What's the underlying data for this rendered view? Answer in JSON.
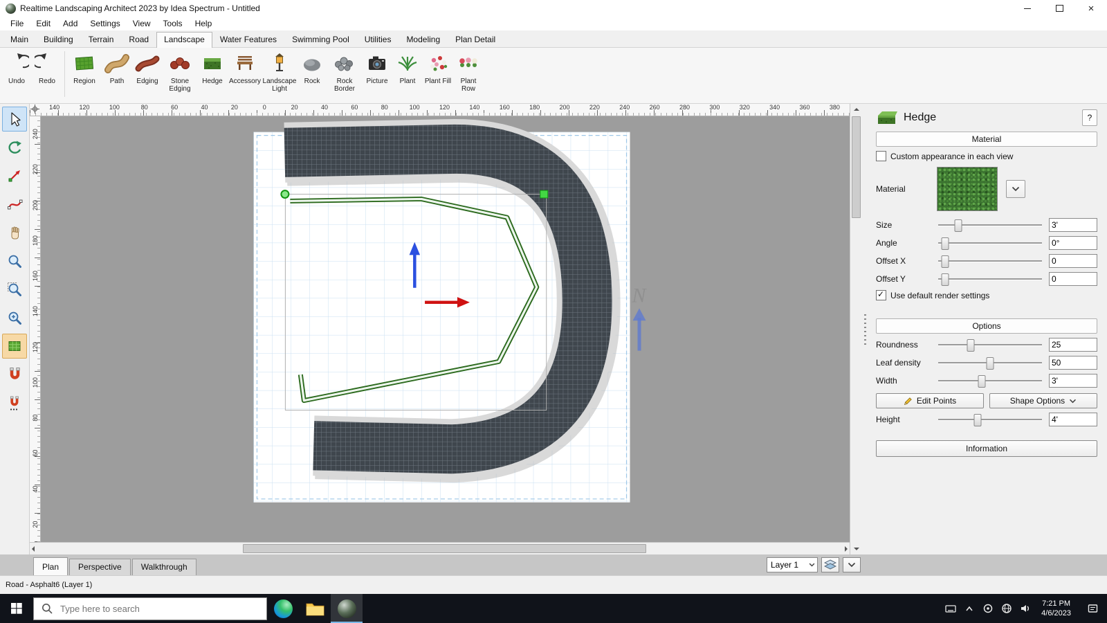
{
  "window": {
    "title": "Realtime Landscaping Architect 2023 by Idea Spectrum - Untitled"
  },
  "menu": [
    "File",
    "Edit",
    "Add",
    "Settings",
    "View",
    "Tools",
    "Help"
  ],
  "ribbon": {
    "tabs": [
      "Main",
      "Building",
      "Terrain",
      "Road",
      "Landscape",
      "Water Features",
      "Swimming Pool",
      "Utilities",
      "Modeling",
      "Plan Detail"
    ],
    "active_tab": "Landscape"
  },
  "toolbar": {
    "labels": [
      "Undo",
      "Redo",
      "Region",
      "Path",
      "Edging",
      "Stone Edging",
      "Hedge",
      "Accessory",
      "Landscape Light",
      "Rock",
      "Rock Border",
      "Picture",
      "Plant",
      "Plant Fill",
      "Plant Row"
    ]
  },
  "rulers": {
    "horizontal": [
      "140",
      "120",
      "100",
      "80",
      "60",
      "40",
      "20",
      "0",
      "20",
      "40",
      "60",
      "80",
      "100",
      "120",
      "140",
      "160",
      "180",
      "200",
      "220",
      "240",
      "260",
      "280",
      "300",
      "320",
      "340",
      "360",
      "380"
    ],
    "vertical": [
      "240",
      "220",
      "200",
      "180",
      "160",
      "140",
      "120",
      "100",
      "80",
      "60",
      "40",
      "20"
    ]
  },
  "canvas": {
    "north_label": "N"
  },
  "panel": {
    "title": "Hedge",
    "help_label": "?",
    "material_header": "Material",
    "custom_appearance_label": "Custom appearance in each view",
    "material_label": "Material",
    "size": {
      "label": "Size",
      "value": "3'"
    },
    "angle": {
      "label": "Angle",
      "value": "0°"
    },
    "offset_x": {
      "label": "Offset X",
      "value": "0"
    },
    "offset_y": {
      "label": "Offset Y",
      "value": "0"
    },
    "use_default_label": "Use default render settings",
    "options_header": "Options",
    "roundness": {
      "label": "Roundness",
      "value": "25"
    },
    "leaf_density": {
      "label": "Leaf density",
      "value": "50"
    },
    "width": {
      "label": "Width",
      "value": "3'"
    },
    "edit_points_label": "Edit Points",
    "shape_options_label": "Shape Options",
    "height": {
      "label": "Height",
      "value": "4'"
    },
    "information_label": "Information"
  },
  "view_tabs": [
    "Plan",
    "Perspective",
    "Walkthrough"
  ],
  "layers": {
    "current": "Layer 1"
  },
  "status": {
    "text": "Road - Asphalt6 (Layer 1)"
  },
  "taskbar": {
    "search_placeholder": "Type here to search",
    "time": "7:21 PM",
    "date": "4/6/2023"
  }
}
